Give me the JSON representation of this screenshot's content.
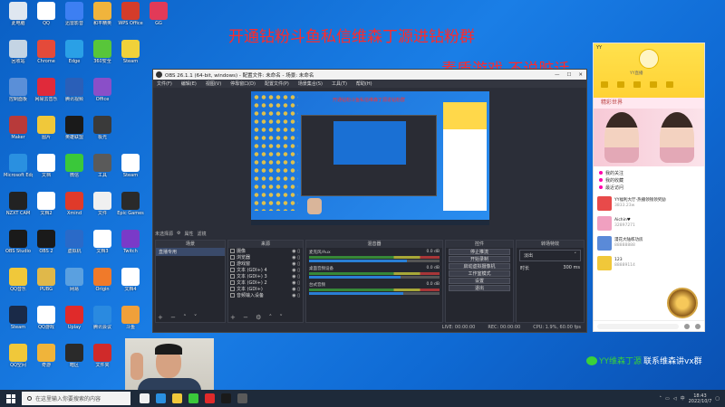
{
  "desktop": {
    "icons": [
      {
        "label": "此电脑",
        "color": "#dfe7f0",
        "col": 0,
        "row": 0
      },
      {
        "label": "QQ",
        "color": "#ffffff",
        "col": 1,
        "row": 0
      },
      {
        "label": "迅雷影音",
        "color": "#3d7ff2",
        "col": 2,
        "row": 0
      },
      {
        "label": "和平精英",
        "color": "#f0b43c",
        "col": 3,
        "row": 0
      },
      {
        "label": "WPS Office",
        "color": "#d43c2a",
        "col": 4,
        "row": 0
      },
      {
        "label": "GG",
        "color": "#e23a58",
        "col": 5,
        "row": 0
      },
      {
        "label": "回收站",
        "color": "#c4d4e4",
        "col": 0,
        "row": 1
      },
      {
        "label": "Chrome",
        "color": "#e44a3a",
        "col": 1,
        "row": 1
      },
      {
        "label": "Edge",
        "color": "#2aa0e6",
        "col": 2,
        "row": 1
      },
      {
        "label": "360安全",
        "color": "#58c63a",
        "col": 3,
        "row": 1
      },
      {
        "label": "Steam",
        "color": "#f0d23a",
        "col": 4,
        "row": 1
      },
      {
        "label": "控制面板",
        "color": "#5a8fd8",
        "col": 0,
        "row": 2
      },
      {
        "label": "网易云音乐",
        "color": "#e02a3a",
        "col": 1,
        "row": 2
      },
      {
        "label": "腾讯视频",
        "color": "#2a5fb8",
        "col": 2,
        "row": 2
      },
      {
        "label": "Office",
        "color": "#8a4fc8",
        "col": 3,
        "row": 2
      },
      {
        "label": "Maker",
        "color": "#b83a3a",
        "col": 0,
        "row": 3
      },
      {
        "label": "图片",
        "color": "#f0c83a",
        "col": 1,
        "row": 3
      },
      {
        "label": "英雄联盟",
        "color": "#1a1a1a",
        "col": 2,
        "row": 3
      },
      {
        "label": "极光",
        "color": "#3a3a3a",
        "col": 3,
        "row": 3
      },
      {
        "label": "Microsoft Edge",
        "color": "#2a90e0",
        "col": 0,
        "row": 4
      },
      {
        "label": "文档",
        "color": "#ffffff",
        "col": 1,
        "row": 4
      },
      {
        "label": "微信",
        "color": "#3ac83a",
        "col": 2,
        "row": 4
      },
      {
        "label": "工具",
        "color": "#5a5a5a",
        "col": 3,
        "row": 4
      },
      {
        "label": "Steam",
        "color": "#ffffff",
        "col": 4,
        "row": 4
      },
      {
        "label": "NZXT CAM",
        "color": "#222222",
        "col": 0,
        "row": 5
      },
      {
        "label": "文档2",
        "color": "#ffffff",
        "col": 1,
        "row": 5
      },
      {
        "label": "Xmind",
        "color": "#e03a2a",
        "col": 2,
        "row": 5
      },
      {
        "label": "文件",
        "color": "#f0f0f0",
        "col": 3,
        "row": 5
      },
      {
        "label": "Epic Games",
        "color": "#2a2a2a",
        "col": 4,
        "row": 5
      },
      {
        "label": "OBS Studio",
        "color": "#1a1a1a",
        "col": 0,
        "row": 6
      },
      {
        "label": "OBS 2",
        "color": "#1a1a1a",
        "col": 1,
        "row": 6
      },
      {
        "label": "虚拟机",
        "color": "#2a6ac8",
        "col": 2,
        "row": 6
      },
      {
        "label": "文档3",
        "color": "#ffffff",
        "col": 3,
        "row": 6
      },
      {
        "label": "Twitch",
        "color": "#7a3ac8",
        "col": 4,
        "row": 6
      },
      {
        "label": "QQ音乐",
        "color": "#f0c83a",
        "col": 0,
        "row": 7
      },
      {
        "label": "PUBG",
        "color": "#e0b84a",
        "col": 1,
        "row": 7
      },
      {
        "label": "网易",
        "color": "#5aa0e0",
        "col": 2,
        "row": 7
      },
      {
        "label": "Origin",
        "color": "#f07a2a",
        "col": 3,
        "row": 7
      },
      {
        "label": "文档4",
        "color": "#ffffff",
        "col": 4,
        "row": 7
      },
      {
        "label": "Steam",
        "color": "#1a2a48",
        "col": 0,
        "row": 8
      },
      {
        "label": "QQ游戏",
        "color": "#ffffff",
        "col": 1,
        "row": 8
      },
      {
        "label": "Uplay",
        "color": "#e02a2a",
        "col": 2,
        "row": 8
      },
      {
        "label": "腾讯会议",
        "color": "#2a8ae0",
        "col": 3,
        "row": 8
      },
      {
        "label": "斗鱼",
        "color": "#f0a03a",
        "col": 4,
        "row": 8
      },
      {
        "label": "QQ空间",
        "color": "#f0c83a",
        "col": 0,
        "row": 9
      },
      {
        "label": "奇游",
        "color": "#f0b43a",
        "col": 1,
        "row": 9
      },
      {
        "label": "暗区",
        "color": "#2a2a2a",
        "col": 2,
        "row": 9
      },
      {
        "label": "文件夹",
        "color": "#d02a2a",
        "col": 3,
        "row": 9
      }
    ]
  },
  "banner": {
    "line1": "开通钻粉斗鱼私信维森丁源进钻粉群",
    "line2": "素质游戏 不说脏话"
  },
  "obs": {
    "title": "OBS 26.1.1 (64-bit, windows) - 配置文件: 未命名 - 场景: 未命名",
    "menu": [
      "文件(F)",
      "编辑(E)",
      "视图(V)",
      "停靠窗口(D)",
      "配置文件(P)",
      "场景集合(S)",
      "工具(T)",
      "帮助(H)"
    ],
    "preview_title": "开通钻粉斗鱼私信维森丁源进钻粉群",
    "ctrl_label": "未选择源",
    "ctrl_props": "属性",
    "ctrl_filters": "滤镜",
    "docks": {
      "scenes": {
        "header": "场景",
        "items": [
          "直播专用"
        ]
      },
      "sources": {
        "header": "来源",
        "items": [
          "摄像",
          "浏览器",
          "游戏窗",
          "文本 (GDI+) 4",
          "文本 (GDI+) 3",
          "文本 (GDI+) 2",
          "文本 (GDI+)",
          "音频输入设备"
        ]
      },
      "mixer": {
        "header": "混音器",
        "channels": [
          {
            "name": "麦克风/Aux",
            "db": "0.0 dB",
            "level": 0.75
          },
          {
            "name": "桌面音频设备",
            "db": "0.0 dB",
            "level": 0.7
          },
          {
            "name": "台式音频",
            "db": "0.0 dB",
            "level": 0.72
          }
        ]
      },
      "controls": {
        "header": "控件",
        "buttons": [
          "停止推流",
          "开始录制",
          "启动虚拟摄像机",
          "工作室模式",
          "设置",
          "退出"
        ]
      },
      "transitions": {
        "header": "转场特效",
        "type": "淡出",
        "duration_label": "时长",
        "duration": "300 ms"
      }
    },
    "status": {
      "live": "LIVE: 00:00:00",
      "rec": "REC: 00:00:00",
      "cpu": "CPU: 1.9%, 60.00 fps"
    }
  },
  "yy": {
    "brand": "YY",
    "tagline": "YY直播",
    "feature": "精彩世界",
    "links": [
      "我的关注",
      "我的收藏",
      "最近访问"
    ],
    "list": [
      {
        "title": "YY福利大厅-热播领钱领奖励",
        "sub": "3833.23w",
        "color": "#e84a4a"
      },
      {
        "title": "Aichin♥",
        "sub": "32897271",
        "color": "#f0a0c0"
      },
      {
        "title": "漫花大陆练功房",
        "sub": "88888888",
        "color": "#5a8ad8"
      },
      {
        "title": "123",
        "sub": "88889114",
        "color": "#f0c83a"
      }
    ]
  },
  "wechat": {
    "id": "YY维森丁源",
    "text": "联系维森讲vx群"
  },
  "taskbar": {
    "search_placeholder": "在这里输入你要搜索的内容",
    "time": "18:43",
    "date": "2022/10/7",
    "apps": [
      "#f0f0f0",
      "#2a90e0",
      "#f0c83a",
      "#3ac83a",
      "#e02a2a",
      "#1a1a1a",
      "#5a5a5a"
    ]
  }
}
